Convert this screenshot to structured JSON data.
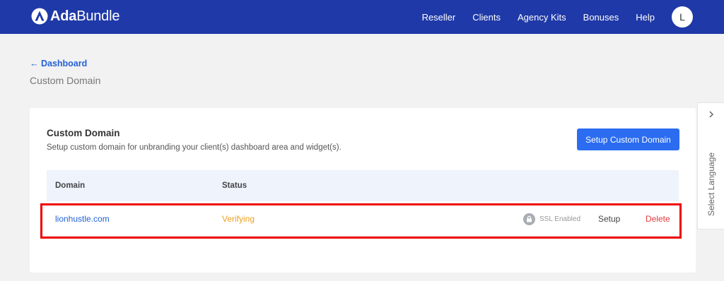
{
  "brand": {
    "name_bold": "Ada",
    "name_regular": "Bundle",
    "icon": "ada-logo-icon"
  },
  "nav": {
    "items": [
      "Reseller",
      "Clients",
      "Agency Kits",
      "Bonuses",
      "Help"
    ],
    "avatar_initial": "L"
  },
  "breadcrumb": {
    "back_label": "← Dashboard",
    "page_title": "Custom Domain"
  },
  "card": {
    "title": "Custom Domain",
    "subtitle": "Setup custom domain for unbranding your client(s) dashboard area and widget(s).",
    "setup_button": "Setup Custom Domain"
  },
  "table": {
    "columns": [
      "Domain",
      "Status"
    ],
    "rows": [
      {
        "domain": "lionhustle.com",
        "status": "Verifying",
        "ssl_label": "SSL Enabled",
        "setup_action": "Setup",
        "delete_action": "Delete"
      }
    ]
  },
  "language_widget": {
    "label": "Select Language",
    "icon": "chevron-right-icon"
  },
  "colors": {
    "topbar": "#1f39a8",
    "primary": "#2b6cf0",
    "link": "#2361d6",
    "status_pending": "#f0a020",
    "danger": "#e23b3b",
    "highlight": "#ee0000"
  }
}
